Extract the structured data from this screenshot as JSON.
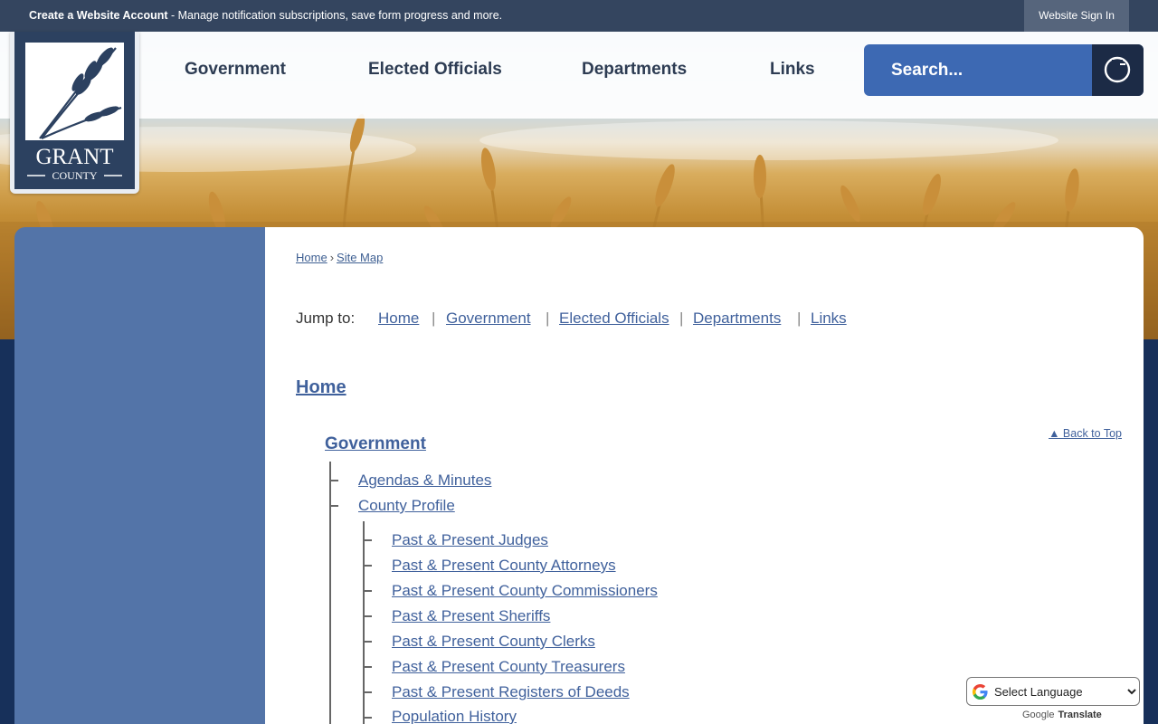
{
  "topbar": {
    "account_link": "Create a Website Account",
    "account_message": " - Manage notification subscriptions, save form progress and more.",
    "signin_label": "Website Sign In"
  },
  "logo": {
    "line1": "GRANT",
    "line2": "COUNTY"
  },
  "nav": {
    "items": [
      {
        "label": "Government"
      },
      {
        "label": "Elected Officials"
      },
      {
        "label": "Departments"
      },
      {
        "label": "Links"
      }
    ]
  },
  "search": {
    "placeholder": "Search..."
  },
  "breadcrumb": {
    "home": "Home",
    "separator": "›",
    "current": "Site Map"
  },
  "jump": {
    "label": "Jump to:",
    "links": [
      "Home",
      "Government",
      "Elected Officials",
      "Departments",
      "Links"
    ],
    "separator": "|"
  },
  "sitemap": {
    "home": "Home",
    "section": "Government",
    "back_to_top": "▲ Back to Top",
    "level1": [
      "Agendas & Minutes",
      "County Profile"
    ],
    "level2": [
      "Past & Present Judges",
      "Past & Present County Attorneys",
      "Past & Present County Commissioners",
      "Past & Present Sheriffs",
      "Past & Present County Clerks",
      "Past & Present County Treasurers",
      "Past & Present Registers of Deeds",
      "Population History"
    ]
  },
  "translate": {
    "select_label": "Select Language",
    "powered_by": "Google",
    "translate_word": "Translate"
  },
  "colors": {
    "accent": "#3d69b3",
    "dark": "#1c2b46",
    "sidebar": "#5374a8",
    "link": "#40619c"
  }
}
